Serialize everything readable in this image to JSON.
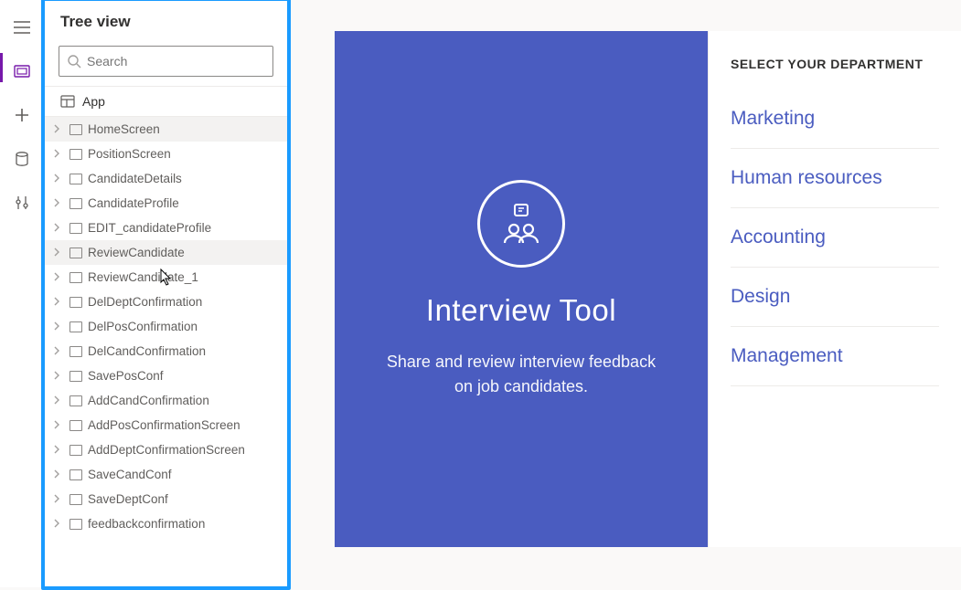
{
  "panel": {
    "title": "Tree view",
    "search_placeholder": "Search",
    "app_label": "App",
    "tree": [
      {
        "label": "HomeScreen",
        "selected": true,
        "has_more": true
      },
      {
        "label": "PositionScreen"
      },
      {
        "label": "CandidateDetails"
      },
      {
        "label": "CandidateProfile"
      },
      {
        "label": "EDIT_candidateProfile"
      },
      {
        "label": "ReviewCandidate",
        "hover": true,
        "has_more": true
      },
      {
        "label": "ReviewCandidate_1"
      },
      {
        "label": "DelDeptConfirmation"
      },
      {
        "label": "DelPosConfirmation"
      },
      {
        "label": "DelCandConfirmation"
      },
      {
        "label": "SavePosConf"
      },
      {
        "label": "AddCandConfirmation"
      },
      {
        "label": "AddPosConfirmationScreen"
      },
      {
        "label": "AddDeptConfirmationScreen"
      },
      {
        "label": "SaveCandConf"
      },
      {
        "label": "SaveDeptConf"
      },
      {
        "label": "feedbackconfirmation"
      }
    ]
  },
  "phone": {
    "title": "Interview Tool",
    "subtitle": "Share and review interview feedback on job candidates."
  },
  "departments": {
    "heading": "SELECT YOUR DEPARTMENT",
    "items": [
      "Marketing",
      "Human resources",
      "Accounting",
      "Design",
      "Management"
    ]
  }
}
